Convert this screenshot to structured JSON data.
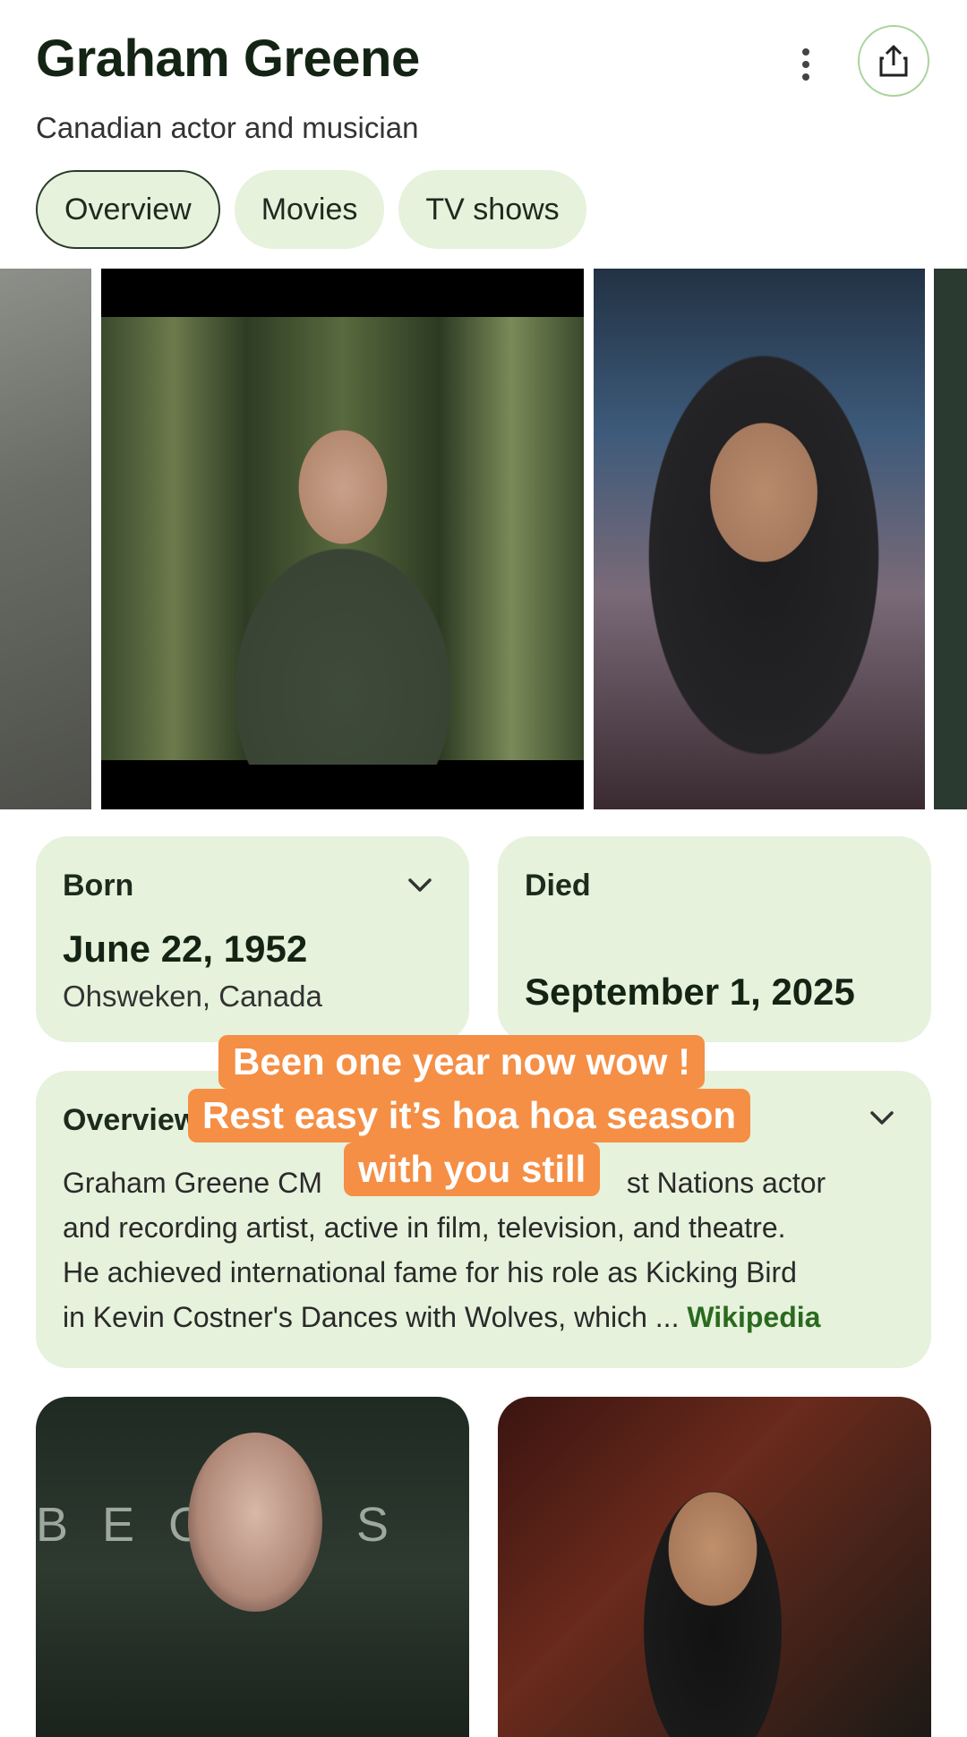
{
  "header": {
    "title": "Graham Greene",
    "subtitle": "Canadian actor and musician"
  },
  "tabs": [
    {
      "label": "Overview",
      "active": true
    },
    {
      "label": "Movies",
      "active": false
    },
    {
      "label": "TV shows",
      "active": false
    }
  ],
  "facts": {
    "born": {
      "label": "Born",
      "date": "June 22, 1952",
      "place": "Ohsweken, Canada"
    },
    "died": {
      "label": "Died",
      "date": "September 1, 2025"
    }
  },
  "overview": {
    "label": "Overview",
    "text_lines": [
      "Graham Greene CM",
      "st Nations actor",
      "and recording artist, active in film, television, and theatre.",
      "He achieved international fame for his role as Kicking Bird",
      "in Kevin Costner's Dances with Wolves, which"
    ],
    "ellipsis": "...",
    "source": "Wikipedia"
  },
  "caption": {
    "lines": [
      "Been one year now wow !",
      "Rest easy it’s hoa hoa season",
      "with you still"
    ]
  },
  "bottom_images": {
    "poster_letters": "BEGINS"
  },
  "colors": {
    "card_bg": "#e6f2dc",
    "caption_bg": "#f58f45",
    "link": "#2a6a1e"
  },
  "icons": [
    "more-vert-icon",
    "share-icon",
    "chevron-down-icon"
  ]
}
